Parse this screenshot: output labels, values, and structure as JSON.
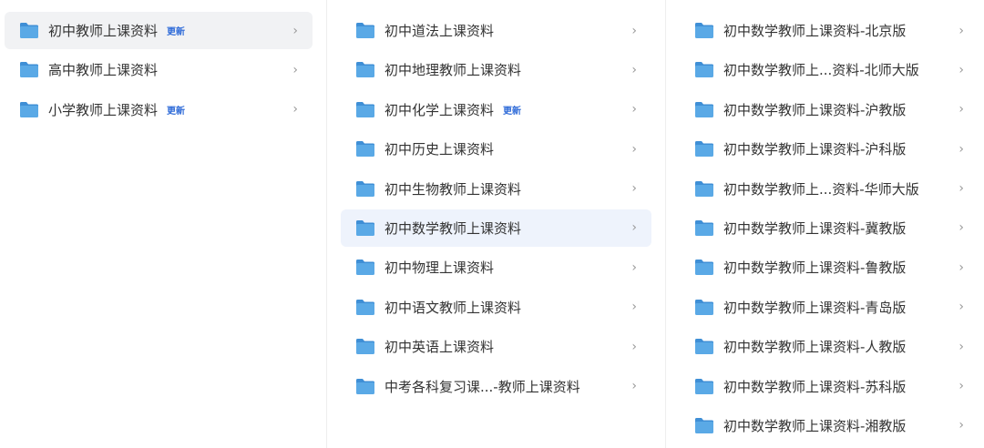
{
  "colors": {
    "folder": "#5aa9e6",
    "folder_tab": "#3f8fd6",
    "badge": "#2f6bd8",
    "chevron": "#9a9a9a"
  },
  "chevron_glyph": "›",
  "col1": {
    "items": [
      {
        "label": "初中教师上课资料",
        "badge": "更新",
        "selected": true
      },
      {
        "label": "高中教师上课资料",
        "badge": ""
      },
      {
        "label": "小学教师上课资料",
        "badge": "更新"
      }
    ]
  },
  "col2": {
    "items": [
      {
        "label": "初中道法上课资料",
        "badge": ""
      },
      {
        "label": "初中地理教师上课资料",
        "badge": ""
      },
      {
        "label": "初中化学上课资料",
        "badge": "更新"
      },
      {
        "label": "初中历史上课资料",
        "badge": ""
      },
      {
        "label": "初中生物教师上课资料",
        "badge": ""
      },
      {
        "label": "初中数学教师上课资料",
        "badge": "",
        "selected": true
      },
      {
        "label": "初中物理上课资料",
        "badge": ""
      },
      {
        "label": "初中语文教师上课资料",
        "badge": ""
      },
      {
        "label": "初中英语上课资料",
        "badge": ""
      },
      {
        "label": "中考各科复习课...-教师上课资料",
        "badge": ""
      }
    ]
  },
  "col3": {
    "items": [
      {
        "label": "初中数学教师上课资料-北京版"
      },
      {
        "label": "初中数学教师上...资料-北师大版"
      },
      {
        "label": "初中数学教师上课资料-沪教版"
      },
      {
        "label": "初中数学教师上课资料-沪科版"
      },
      {
        "label": "初中数学教师上...资料-华师大版"
      },
      {
        "label": "初中数学教师上课资料-冀教版"
      },
      {
        "label": "初中数学教师上课资料-鲁教版"
      },
      {
        "label": "初中数学教师上课资料-青岛版"
      },
      {
        "label": "初中数学教师上课资料-人教版"
      },
      {
        "label": "初中数学教师上课资料-苏科版"
      },
      {
        "label": "初中数学教师上课资料-湘教版"
      }
    ]
  }
}
